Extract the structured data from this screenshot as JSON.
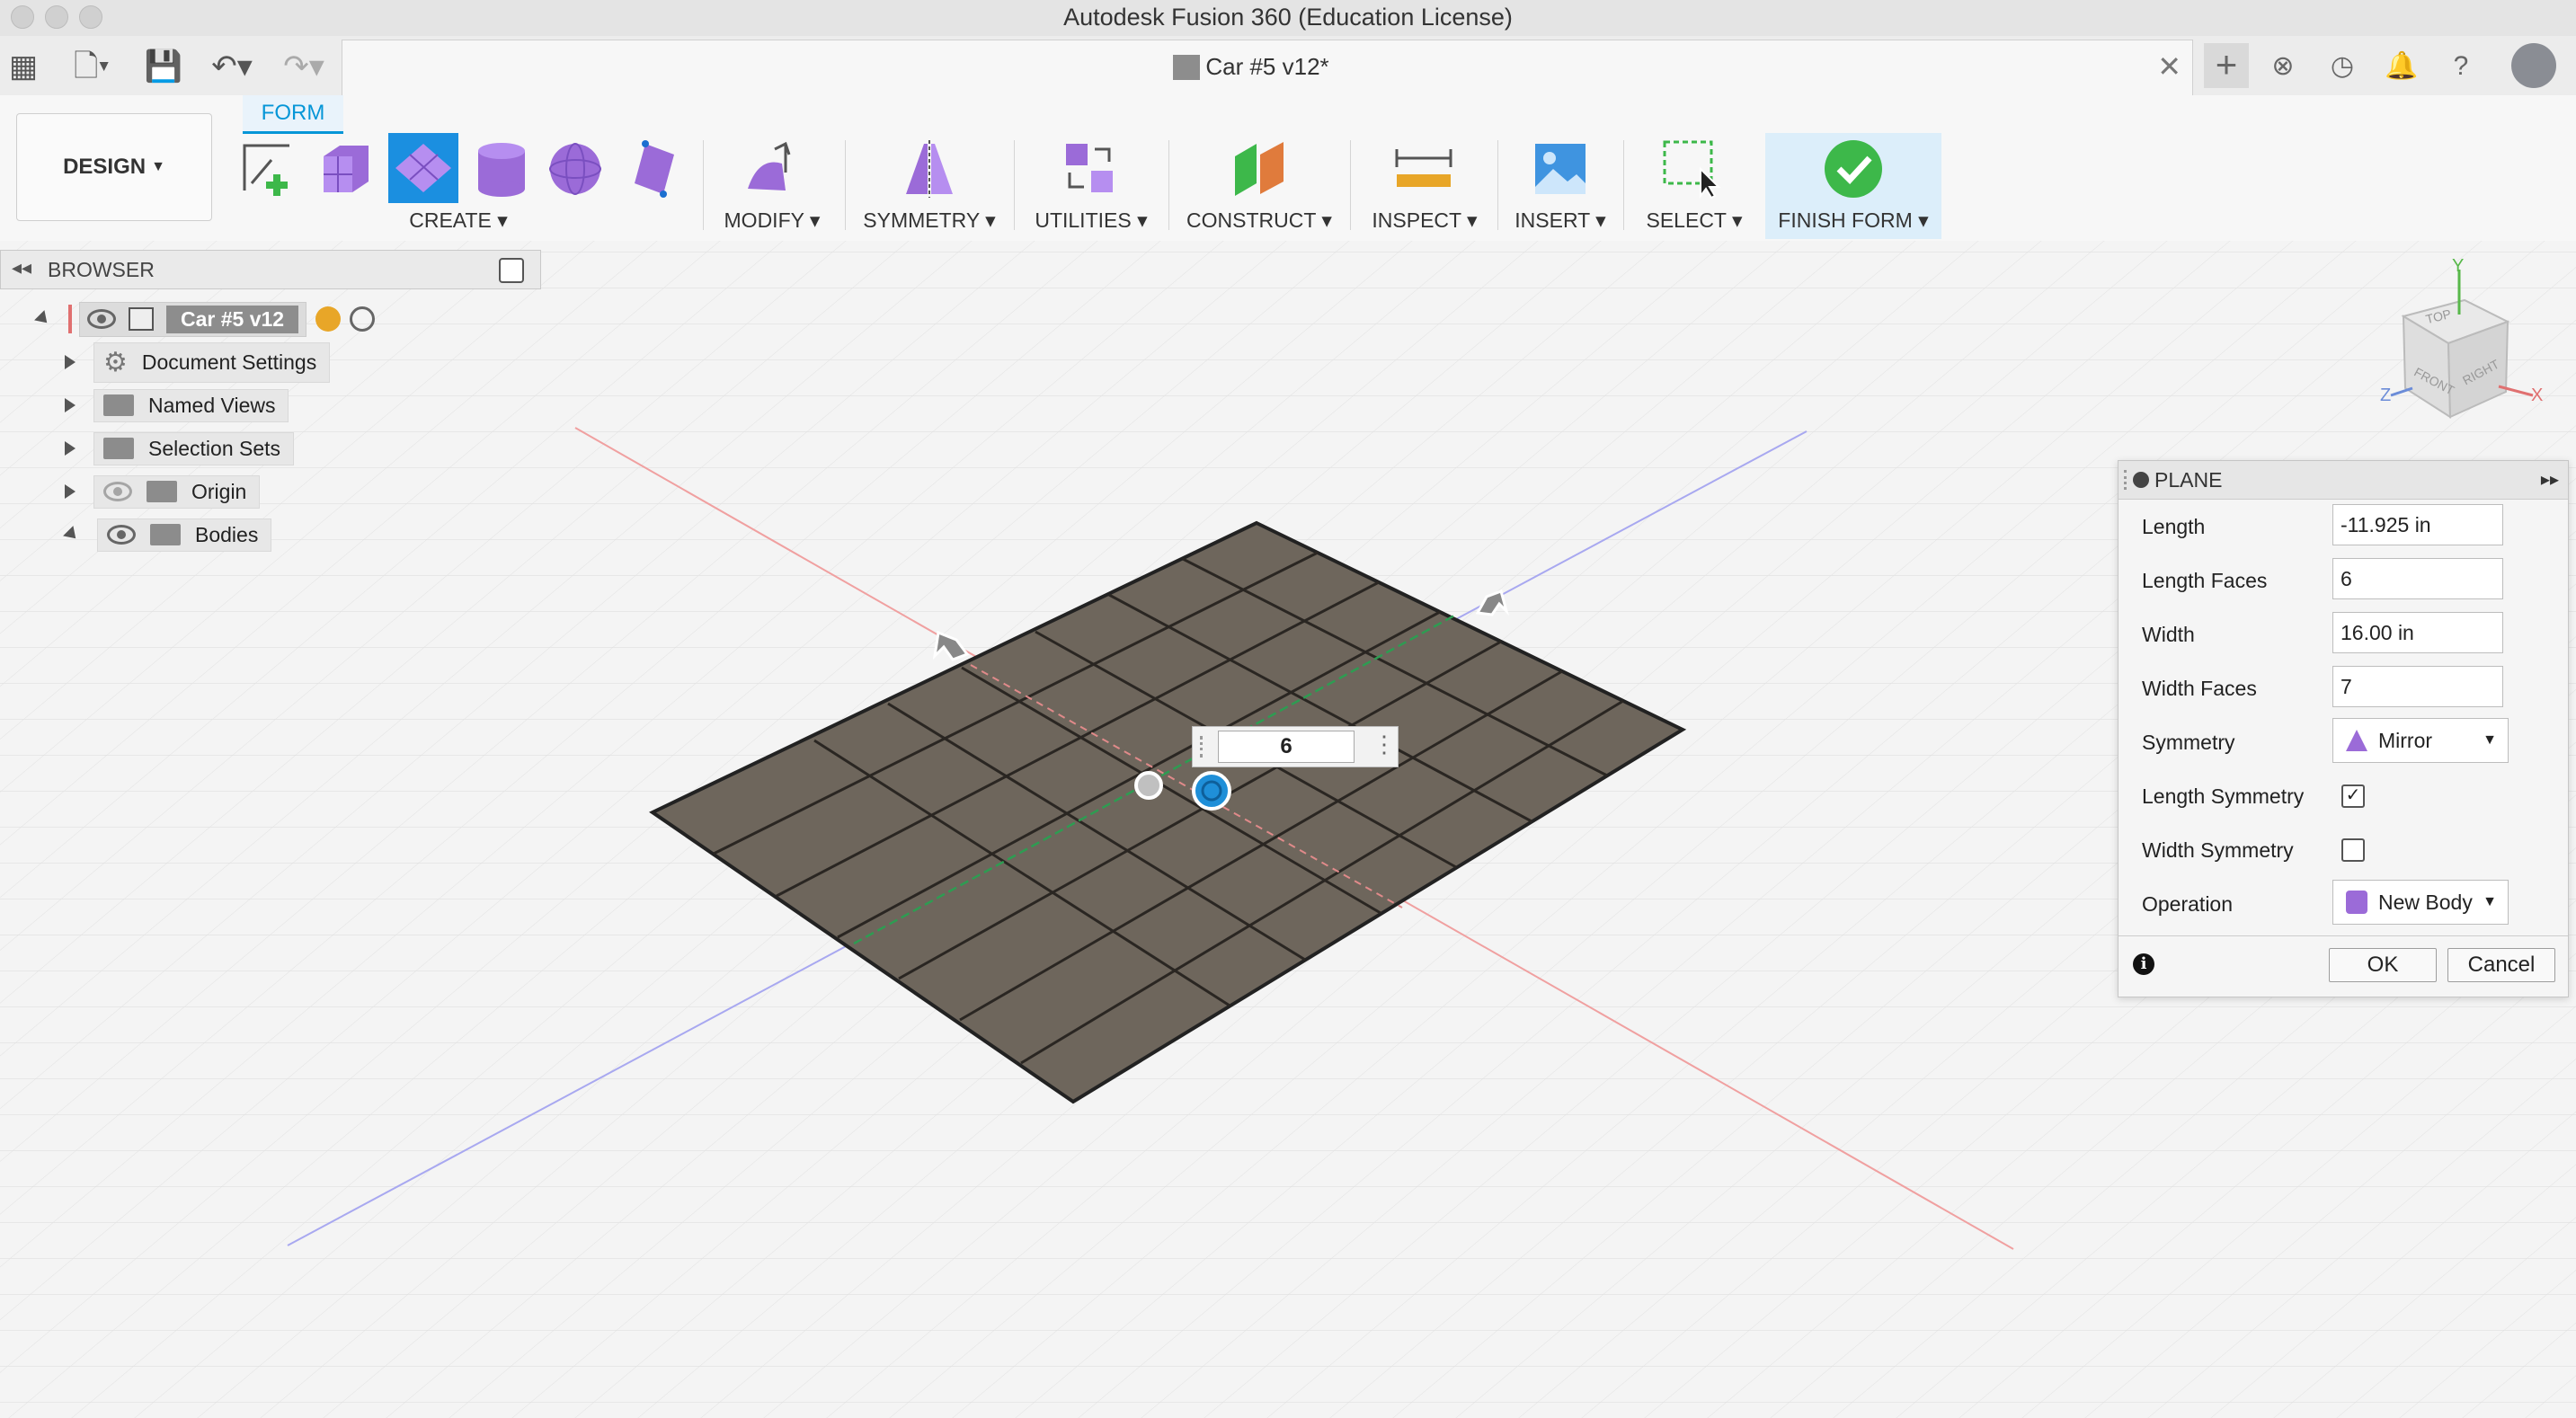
{
  "window": {
    "title": "Autodesk Fusion 360 (Education License)"
  },
  "document": {
    "tab_title": "Car #5 v12*"
  },
  "workspace": {
    "label": "DESIGN"
  },
  "ribbon": {
    "active_tab": "FORM",
    "groups": [
      {
        "label": "CREATE"
      },
      {
        "label": "MODIFY"
      },
      {
        "label": "SYMMETRY"
      },
      {
        "label": "UTILITIES"
      },
      {
        "label": "CONSTRUCT"
      },
      {
        "label": "INSPECT"
      },
      {
        "label": "INSERT"
      },
      {
        "label": "SELECT"
      },
      {
        "label": "FINISH FORM"
      }
    ]
  },
  "browser": {
    "title": "BROWSER",
    "root": "Car #5 v12",
    "items": [
      {
        "label": "Document Settings",
        "icon": "gear-icon"
      },
      {
        "label": "Named Views",
        "icon": "folder-icon"
      },
      {
        "label": "Selection Sets",
        "icon": "folder-icon"
      },
      {
        "label": "Origin",
        "icon": "folder-icon"
      },
      {
        "label": "Bodies",
        "icon": "folder-icon"
      }
    ]
  },
  "viewcube": {
    "top": "TOP",
    "front": "FRONT",
    "right": "RIGHT",
    "x": "X",
    "y": "Y",
    "z": "Z"
  },
  "face_popup": {
    "value": "6"
  },
  "dialog": {
    "title": "PLANE",
    "length_label": "Length",
    "length_value": "-11.925 in",
    "length_faces_label": "Length Faces",
    "length_faces_value": "6",
    "width_label": "Width",
    "width_value": "16.00 in",
    "width_faces_label": "Width Faces",
    "width_faces_value": "7",
    "symmetry_label": "Symmetry",
    "symmetry_value": "Mirror",
    "length_symmetry_label": "Length Symmetry",
    "length_symmetry_checked": "✓",
    "width_symmetry_label": "Width Symmetry",
    "operation_label": "Operation",
    "operation_value": "New Body",
    "ok_label": "OK",
    "cancel_label": "Cancel",
    "info": "i"
  },
  "colors": {
    "accent": "#0696d7",
    "form_purple": "#9b6bd8",
    "plane_fill": "#6e665c",
    "finish_green": "#3db84a"
  }
}
